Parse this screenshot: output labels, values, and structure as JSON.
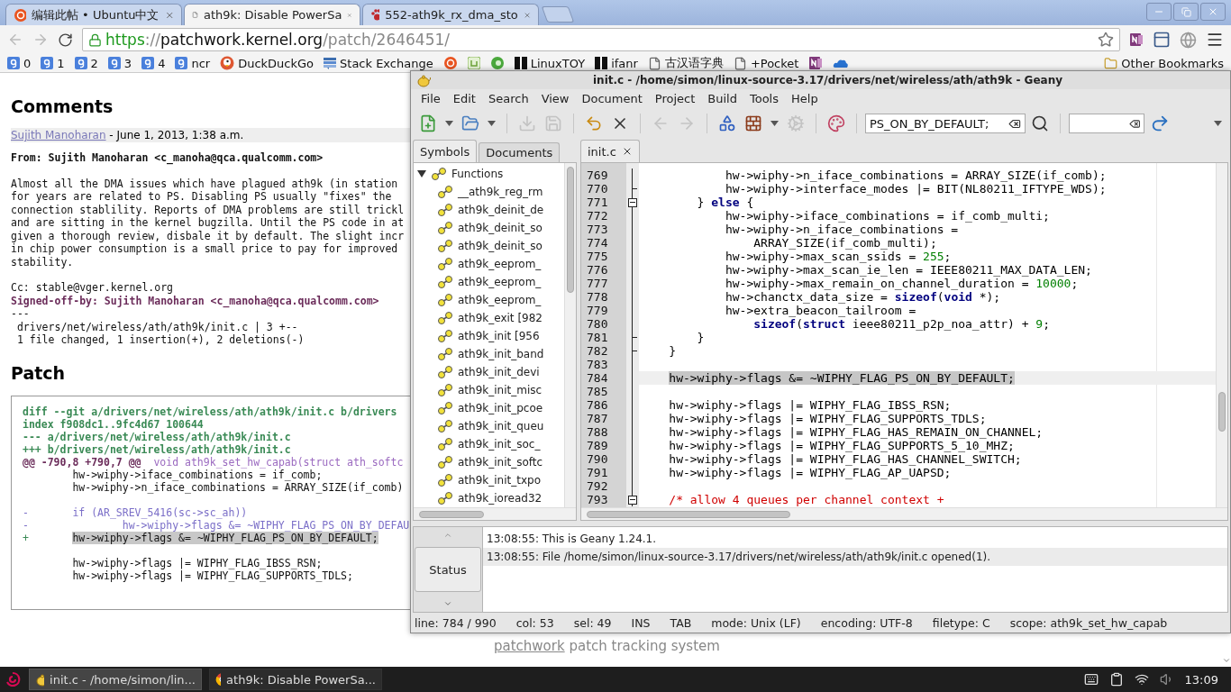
{
  "chrome": {
    "tabs": [
      {
        "title": "编辑此帖 • Ubuntu中文",
        "kind": "ubuntu",
        "selected": false
      },
      {
        "title": "ath9k: Disable PowerSa",
        "kind": "page",
        "selected": true
      },
      {
        "title": "552-ath9k_rx_dma_sto",
        "kind": "paw",
        "selected": false
      }
    ],
    "url": [
      {
        "kind": "scheme",
        "text": "https"
      },
      {
        "kind": "dim",
        "text": "://"
      },
      {
        "kind": "host",
        "text": "patchwork.kernel.org"
      },
      {
        "kind": "dim",
        "text": "/patch/2646451/"
      }
    ],
    "bookmarks": [
      {
        "kind": "google",
        "label": "0"
      },
      {
        "kind": "google",
        "label": "1"
      },
      {
        "kind": "google",
        "label": "2"
      },
      {
        "kind": "google",
        "label": "3"
      },
      {
        "kind": "google",
        "label": "4"
      },
      {
        "kind": "google",
        "label": "ncr"
      },
      {
        "kind": "duck",
        "label": "DuckDuckGo"
      },
      {
        "kind": "stack",
        "label": "Stack Exchange"
      },
      {
        "kind": "ubuntu"
      },
      {
        "kind": "mint"
      },
      {
        "kind": "green"
      },
      {
        "kind": "black",
        "label": "LinuxTOY"
      },
      {
        "kind": "black",
        "label": "ifanr"
      },
      {
        "kind": "page",
        "label": "古汉语字典"
      },
      {
        "kind": "page",
        "label": "+Pocket"
      },
      {
        "kind": "onenote"
      },
      {
        "kind": "cloud"
      }
    ],
    "other_bookmarks": "Other Bookmarks"
  },
  "page": {
    "comments_heading": "Comments",
    "comment": {
      "author": "Sujith Manoharan",
      "date": " - June 1, 2013, 1:38 a.m.",
      "body": [
        {
          "kind": "from",
          "text": "From: Sujith Manoharan <c_manoha@qca.qualcomm.com>"
        },
        {
          "kind": "paragraph",
          "text": "Almost all the DMA issues which have plagued ath9k (in station\nfor years are related to PS. Disabling PS usually \"fixes\" the\nconnection stablility. Reports of DMA problems are still trickl\nand are sitting in the kernel bugzilla. Until the PS code in at\ngiven a thorough review, disbale it by default. The slight incr\nin chip power consumption is a small price to pay for improved\nstability."
        },
        {
          "kind": "plain",
          "text": "Cc: stable@vger.kernel.org"
        },
        {
          "kind": "signoff",
          "text": "Signed-off-by: Sujith Manoharan <c_manoha@qca.qualcomm.com>"
        },
        {
          "kind": "plain",
          "text": "---\n drivers/net/wireless/ath/ath9k/init.c | 3 +--\n 1 file changed, 1 insertion(+), 2 deletions(-)"
        }
      ]
    },
    "patch_heading": "Patch",
    "patch": [
      {
        "kind": "header",
        "text": "diff --git a/drivers/net/wireless/ath/ath9k/init.c b/drivers",
        "highlighted": false
      },
      {
        "kind": "header",
        "text": "index f908dc1..9fc4d67 100644",
        "highlighted": false
      },
      {
        "kind": "header",
        "text": "--- a/drivers/net/wireless/ath/ath9k/init.c",
        "highlighted": false
      },
      {
        "kind": "header",
        "text": "+++ b/drivers/net/wireless/ath/ath9k/init.c",
        "highlighted": false
      },
      {
        "kind": "hunk",
        "text": "@@ -790,8 +790,7 @@",
        "context": "  void ath9k_set_hw_capab(struct ath_softc",
        "highlighted": false
      },
      {
        "kind": "context",
        "text": "        hw->wiphy->iface_combinations = if_comb;",
        "highlighted": false
      },
      {
        "kind": "context",
        "text": "        hw->wiphy->n_iface_combinations = ARRAY_SIZE(if_comb)",
        "highlighted": false
      },
      {
        "kind": "blank"
      },
      {
        "kind": "removed",
        "text": "-       if (AR_SREV_5416(sc->sc_ah))",
        "highlighted": false
      },
      {
        "kind": "removed",
        "text": "-               hw->wiphy->flags &= ~WIPHY_FLAG_PS_ON_BY_DEFAU",
        "highlighted": false
      },
      {
        "kind": "added",
        "sign": "+",
        "text": "       hw->wiphy->flags &= ~WIPHY_FLAG_PS_ON_BY_DEFAULT;",
        "highlighted": true
      },
      {
        "kind": "blank"
      },
      {
        "kind": "context",
        "text": "        hw->wiphy->flags |= WIPHY_FLAG_IBSS_RSN;",
        "highlighted": false
      },
      {
        "kind": "context",
        "text": "        hw->wiphy->flags |= WIPHY_FLAG_SUPPORTS_TDLS;",
        "highlighted": false
      }
    ],
    "footer": {
      "link": "patchwork",
      "text": " patch tracking system"
    }
  },
  "geany": {
    "title": "init.c - /home/simon/linux-source-3.17/drivers/net/wireless/ath/ath9k - Geany",
    "menu": [
      "File",
      "Edit",
      "Search",
      "View",
      "Document",
      "Project",
      "Build",
      "Tools",
      "Help"
    ],
    "toolbar": [
      [
        {
          "kind": "new",
          "disabled": false
        },
        {
          "kind": "dropdown",
          "disabled": false
        },
        {
          "kind": "open",
          "disabled": false
        },
        {
          "kind": "dropdown",
          "disabled": false
        }
      ],
      [
        {
          "kind": "save",
          "disabled": true
        },
        {
          "kind": "saveall",
          "disabled": true
        }
      ],
      [
        {
          "kind": "revert",
          "disabled": false
        },
        {
          "kind": "close",
          "disabled": false
        }
      ],
      [
        {
          "kind": "back",
          "disabled": true
        },
        {
          "kind": "forward",
          "disabled": true
        }
      ],
      [
        {
          "kind": "compile",
          "disabled": false
        },
        {
          "kind": "build",
          "disabled": false
        },
        {
          "kind": "dropdown",
          "disabled": false
        },
        {
          "kind": "execute",
          "disabled": true
        }
      ],
      [
        {
          "kind": "color",
          "disabled": false
        }
      ]
    ],
    "search_value": "PS_ON_BY_DEFAULT;",
    "sidebar_tabs": [
      {
        "label": "Symbols",
        "selected": true
      },
      {
        "label": "Documents",
        "selected": false
      }
    ],
    "symbols": [
      {
        "label": "Functions",
        "expanded": true,
        "children": [
          {
            "label": "__ath9k_reg_rm"
          },
          {
            "label": "ath9k_deinit_de"
          },
          {
            "label": "ath9k_deinit_so"
          },
          {
            "label": "ath9k_deinit_so"
          },
          {
            "label": "ath9k_eeprom_"
          },
          {
            "label": "ath9k_eeprom_"
          },
          {
            "label": "ath9k_eeprom_"
          },
          {
            "label": "ath9k_exit [982"
          },
          {
            "label": "ath9k_init [956"
          },
          {
            "label": "ath9k_init_band"
          },
          {
            "label": "ath9k_init_devi"
          },
          {
            "label": "ath9k_init_misc"
          },
          {
            "label": "ath9k_init_pcoe"
          },
          {
            "label": "ath9k_init_queu"
          },
          {
            "label": "ath9k_init_soc_"
          },
          {
            "label": "ath9k_init_softc"
          },
          {
            "label": "ath9k_init_txpo"
          },
          {
            "label": "ath9k_ioread32"
          }
        ]
      }
    ],
    "documents": [
      {
        "name": "init.c",
        "selected": true
      }
    ],
    "lines": [
      {
        "number": "769",
        "kind": "plain",
        "current": false,
        "segments": [
          {
            "kind": "plain",
            "text": "            hw->wiphy->n_iface_combinations = ARRAY_SIZE(if_comb);"
          }
        ]
      },
      {
        "number": "770",
        "kind": "fold_end",
        "current": false,
        "segments": [
          {
            "kind": "plain",
            "text": "            hw->wiphy->interface_modes |= BIT(NL80211_IFTYPE_WDS);"
          }
        ]
      },
      {
        "number": "771",
        "kind": "fold_start",
        "current": false,
        "segments": [
          {
            "kind": "plain",
            "text": "        } "
          },
          {
            "kind": "keyword",
            "text": "else"
          },
          {
            "kind": "plain",
            "text": " {"
          }
        ]
      },
      {
        "number": "772",
        "kind": "plain",
        "current": false,
        "segments": [
          {
            "kind": "plain",
            "text": "            hw->wiphy->iface_combinations = if_comb_multi;"
          }
        ]
      },
      {
        "number": "773",
        "kind": "plain",
        "current": false,
        "segments": [
          {
            "kind": "plain",
            "text": "            hw->wiphy->n_iface_combinations ="
          }
        ]
      },
      {
        "number": "774",
        "kind": "plain",
        "current": false,
        "segments": [
          {
            "kind": "plain",
            "text": "                ARRAY_SIZE(if_comb_multi);"
          }
        ]
      },
      {
        "number": "775",
        "kind": "plain",
        "current": false,
        "segments": [
          {
            "kind": "plain",
            "text": "            hw->wiphy->max_scan_ssids = "
          },
          {
            "kind": "number",
            "text": "255"
          },
          {
            "kind": "plain",
            "text": ";"
          }
        ]
      },
      {
        "number": "776",
        "kind": "plain",
        "current": false,
        "segments": [
          {
            "kind": "plain",
            "text": "            hw->wiphy->max_scan_ie_len = IEEE80211_MAX_DATA_LEN;"
          }
        ]
      },
      {
        "number": "777",
        "kind": "plain",
        "current": false,
        "segments": [
          {
            "kind": "plain",
            "text": "            hw->wiphy->max_remain_on_channel_duration = "
          },
          {
            "kind": "number",
            "text": "10000"
          },
          {
            "kind": "plain",
            "text": ";"
          }
        ]
      },
      {
        "number": "778",
        "kind": "plain",
        "current": false,
        "segments": [
          {
            "kind": "plain",
            "text": "            hw->chanctx_data_size = "
          },
          {
            "kind": "keyword",
            "text": "sizeof"
          },
          {
            "kind": "plain",
            "text": "("
          },
          {
            "kind": "keyword",
            "text": "void"
          },
          {
            "kind": "plain",
            "text": " *);"
          }
        ]
      },
      {
        "number": "779",
        "kind": "plain",
        "current": false,
        "segments": [
          {
            "kind": "plain",
            "text": "            hw->extra_beacon_tailroom ="
          }
        ]
      },
      {
        "number": "780",
        "kind": "plain",
        "current": false,
        "segments": [
          {
            "kind": "keyword",
            "text": "                sizeof"
          },
          {
            "kind": "plain",
            "text": "("
          },
          {
            "kind": "keyword",
            "text": "struct"
          },
          {
            "kind": "plain",
            "text": " ieee80211_p2p_noa_attr) + "
          },
          {
            "kind": "number",
            "text": "9"
          },
          {
            "kind": "plain",
            "text": ";"
          }
        ]
      },
      {
        "number": "781",
        "kind": "fold_end",
        "current": false,
        "segments": [
          {
            "kind": "plain",
            "text": "        }"
          }
        ]
      },
      {
        "number": "782",
        "kind": "fold_end",
        "current": false,
        "segments": [
          {
            "kind": "plain",
            "text": "    }"
          }
        ]
      },
      {
        "number": "783",
        "kind": "plain",
        "current": false
      },
      {
        "number": "784",
        "kind": "plain",
        "current": true,
        "segments": [
          {
            "kind": "selected",
            "text": "    hw->wiphy->flags &= ~WIPHY_FLAG_PS_ON_BY_DEFAULT;"
          }
        ]
      },
      {
        "number": "785",
        "kind": "plain",
        "current": false
      },
      {
        "number": "786",
        "kind": "plain",
        "current": false,
        "segments": [
          {
            "kind": "plain",
            "text": "    hw->wiphy->flags |= WIPHY_FLAG_IBSS_RSN;"
          }
        ]
      },
      {
        "number": "787",
        "kind": "plain",
        "current": false,
        "segments": [
          {
            "kind": "plain",
            "text": "    hw->wiphy->flags |= WIPHY_FLAG_SUPPORTS_TDLS;"
          }
        ]
      },
      {
        "number": "788",
        "kind": "plain",
        "current": false,
        "segments": [
          {
            "kind": "plain",
            "text": "    hw->wiphy->flags |= WIPHY_FLAG_HAS_REMAIN_ON_CHANNEL;"
          }
        ]
      },
      {
        "number": "789",
        "kind": "plain",
        "current": false,
        "segments": [
          {
            "kind": "plain",
            "text": "    hw->wiphy->flags |= WIPHY_FLAG_SUPPORTS_5_10_MHZ;"
          }
        ]
      },
      {
        "number": "790",
        "kind": "plain",
        "current": false,
        "segments": [
          {
            "kind": "plain",
            "text": "    hw->wiphy->flags |= WIPHY_FLAG_HAS_CHANNEL_SWITCH;"
          }
        ]
      },
      {
        "number": "791",
        "kind": "plain",
        "current": false,
        "segments": [
          {
            "kind": "plain",
            "text": "    hw->wiphy->flags |= WIPHY_FLAG_AP_UAPSD;"
          }
        ]
      },
      {
        "number": "792",
        "kind": "plain",
        "current": false
      },
      {
        "number": "793",
        "kind": "fold_start",
        "current": false,
        "segments": [
          {
            "kind": "comment",
            "text": "    /* allow 4 queues per channel context +"
          }
        ]
      }
    ],
    "messages_tab": "Status",
    "messages": [
      {
        "text": "13:08:55: This is Geany 1.24.1.",
        "selected": false
      },
      {
        "text": "13:08:55: File /home/simon/linux-source-3.17/drivers/net/wireless/ath/ath9k/init.c opened(1).",
        "selected": true
      }
    ],
    "status_bar": [
      "line: 784 / 990",
      "col: 53",
      "sel: 49",
      "INS",
      "TAB",
      "mode: Unix (LF)",
      "encoding: UTF-8",
      "filetype: C",
      "scope: ath9k_set_hw_capab"
    ]
  },
  "taskbar": {
    "tasks": [
      {
        "title": "init.c - /home/simon/lin...",
        "kind": "geany",
        "selected": true
      },
      {
        "title": "ath9k: Disable PowerSa...",
        "kind": "chrome",
        "selected": false
      }
    ],
    "clock": "13:09"
  }
}
